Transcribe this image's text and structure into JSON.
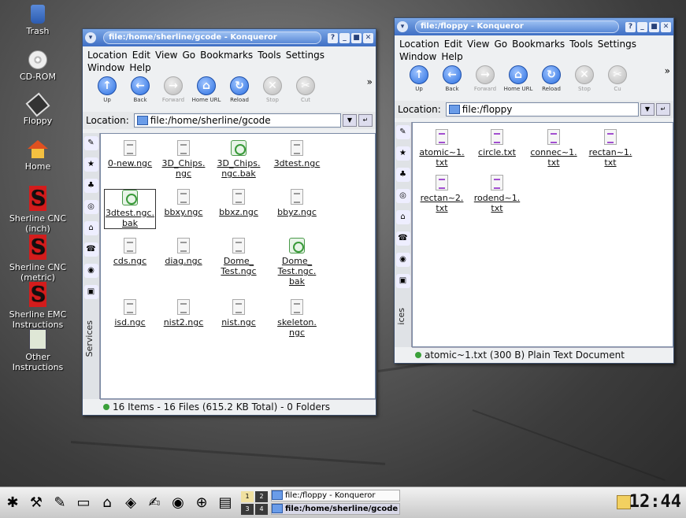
{
  "desktop": {
    "icons": [
      {
        "label": "Trash",
        "icon": "trash-icon"
      },
      {
        "label": "CD-ROM",
        "icon": "cdrom-icon"
      },
      {
        "label": "Floppy",
        "icon": "floppy-icon"
      },
      {
        "label": "Home",
        "icon": "home-icon"
      },
      {
        "label": "Sherline CNC\n(inch)",
        "icon": "sherline-icon"
      },
      {
        "label": "Sherline CNC\n(metric)",
        "icon": "sherline-icon"
      },
      {
        "label": "Sherline EMC\nInstructions",
        "icon": "sherline-icon"
      },
      {
        "label": "Other\nInstructions",
        "icon": "book-icon"
      }
    ]
  },
  "win1": {
    "title": "file:/home/sherline/gcode - Konqueror",
    "menu": [
      "Location",
      "Edit",
      "View",
      "Go",
      "Bookmarks",
      "Tools",
      "Settings",
      "Window",
      "Help"
    ],
    "toolbar": [
      "Up",
      "Back",
      "Forward",
      "Home URL",
      "Reload",
      "Stop",
      "Cut"
    ],
    "location_label": "Location:",
    "location_value": "file:/home/sherline/gcode",
    "sidebar_label": "Services",
    "files": [
      {
        "name": "0-new.ngc",
        "type": "text"
      },
      {
        "name": "3D_Chips.\nngc",
        "type": "text"
      },
      {
        "name": "3D_Chips.\nngc.bak",
        "type": "bak"
      },
      {
        "name": "3dtest.ngc",
        "type": "text"
      },
      {
        "name": "3dtest.ngc.\nbak",
        "type": "bak"
      },
      {
        "name": "bbxy.ngc",
        "type": "text"
      },
      {
        "name": "bbxz.ngc",
        "type": "text"
      },
      {
        "name": "bbyz.ngc",
        "type": "text"
      },
      {
        "name": "cds.ngc",
        "type": "text"
      },
      {
        "name": "diag.ngc",
        "type": "text"
      },
      {
        "name": "Dome_\nTest.ngc",
        "type": "text"
      },
      {
        "name": "Dome_\nTest.ngc.\nbak",
        "type": "bak"
      },
      {
        "name": "isd.ngc",
        "type": "text"
      },
      {
        "name": "nist2.ngc",
        "type": "text"
      },
      {
        "name": "nist.ngc",
        "type": "text"
      },
      {
        "name": "skeleton.\nngc",
        "type": "text"
      }
    ],
    "status": "16 Items - 16 Files (615.2 KB Total) - 0 Folders"
  },
  "win2": {
    "title": "file:/floppy - Konqueror",
    "menu": [
      "Location",
      "Edit",
      "View",
      "Go",
      "Bookmarks",
      "Tools",
      "Settings",
      "Window",
      "Help"
    ],
    "toolbar": [
      "Up",
      "Back",
      "Forward",
      "Home URL",
      "Reload",
      "Stop",
      "Cu"
    ],
    "location_label": "Location:",
    "location_value": "file:/floppy",
    "sidebar_label": "ices",
    "files": [
      {
        "name": "atomic~1.\ntxt",
        "type": "txt"
      },
      {
        "name": "circle.txt",
        "type": "txt"
      },
      {
        "name": "connec~1.\ntxt",
        "type": "txt"
      },
      {
        "name": "rectan~1.\ntxt",
        "type": "txt"
      },
      {
        "name": "rectan~2.\ntxt",
        "type": "txt"
      },
      {
        "name": "rodend~1.\ntxt",
        "type": "txt"
      }
    ],
    "status": "atomic~1.txt (300 B)  Plain Text Document"
  },
  "taskbar": {
    "pager": [
      "1",
      "2",
      "3",
      "4"
    ],
    "tasks": [
      "file:/floppy - Konqueror",
      "file:/home/sherline/gcode"
    ],
    "clock": "12:44"
  }
}
